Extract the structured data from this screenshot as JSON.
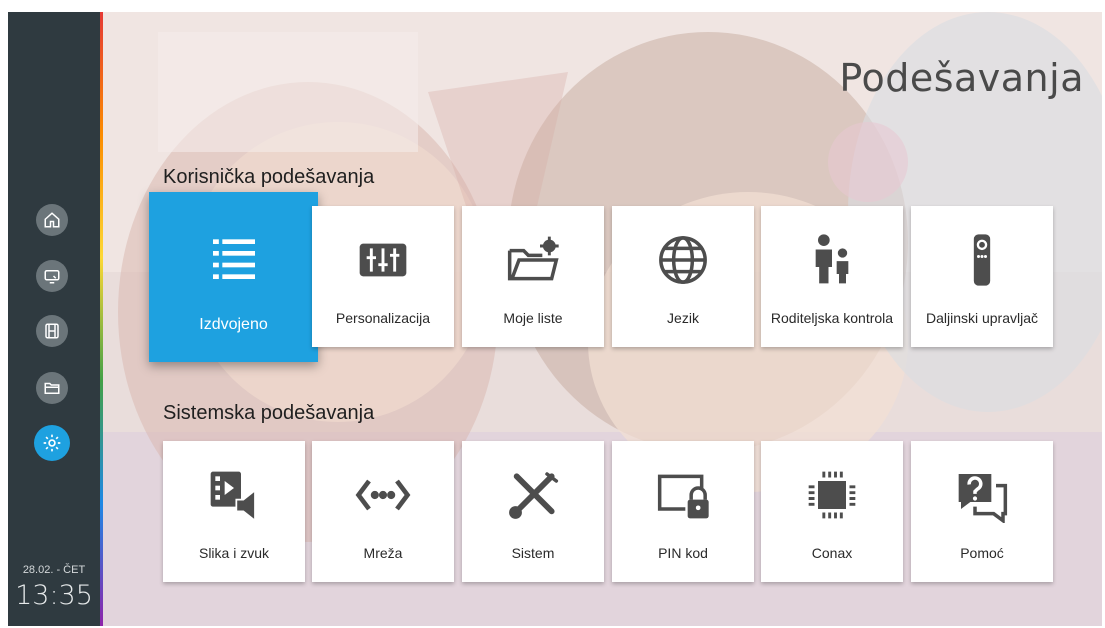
{
  "page": {
    "title": "Podešavanja"
  },
  "sidebar": {
    "items": [
      {
        "name": "home",
        "icon": "home-icon"
      },
      {
        "name": "tv",
        "icon": "tv-icon"
      },
      {
        "name": "movies",
        "icon": "film-icon"
      },
      {
        "name": "recordings",
        "icon": "folder-icon"
      },
      {
        "name": "settings",
        "icon": "gear-icon",
        "active": true
      }
    ],
    "date": "28.02. - ČET",
    "time": "13:35"
  },
  "sections": {
    "user": {
      "title": "Korisnička podešavanja",
      "tiles": [
        {
          "label": "Izdvojeno",
          "icon": "list-icon",
          "selected": true
        },
        {
          "label": "Personalizacija",
          "icon": "sliders-icon"
        },
        {
          "label": "Moje liste",
          "icon": "folder-gear-icon"
        },
        {
          "label": "Jezik",
          "icon": "globe-icon"
        },
        {
          "label": "Roditeljska kontrola",
          "icon": "parent-child-icon"
        },
        {
          "label": "Daljinski upravljač",
          "icon": "remote-icon"
        }
      ]
    },
    "system": {
      "title": "Sistemska podešavanja",
      "tiles": [
        {
          "label": "Slika i zvuk",
          "icon": "film-speaker-icon"
        },
        {
          "label": "Mreža",
          "icon": "network-icon"
        },
        {
          "label": "Sistem",
          "icon": "tools-icon"
        },
        {
          "label": "PIN kod",
          "icon": "screen-lock-icon"
        },
        {
          "label": "Conax",
          "icon": "chip-icon"
        },
        {
          "label": "Pomoć",
          "icon": "help-chat-icon"
        }
      ]
    }
  },
  "colors": {
    "accent": "#1ea1e0",
    "sidebar": "#2f3a40",
    "icon": "#4d4d4d"
  }
}
